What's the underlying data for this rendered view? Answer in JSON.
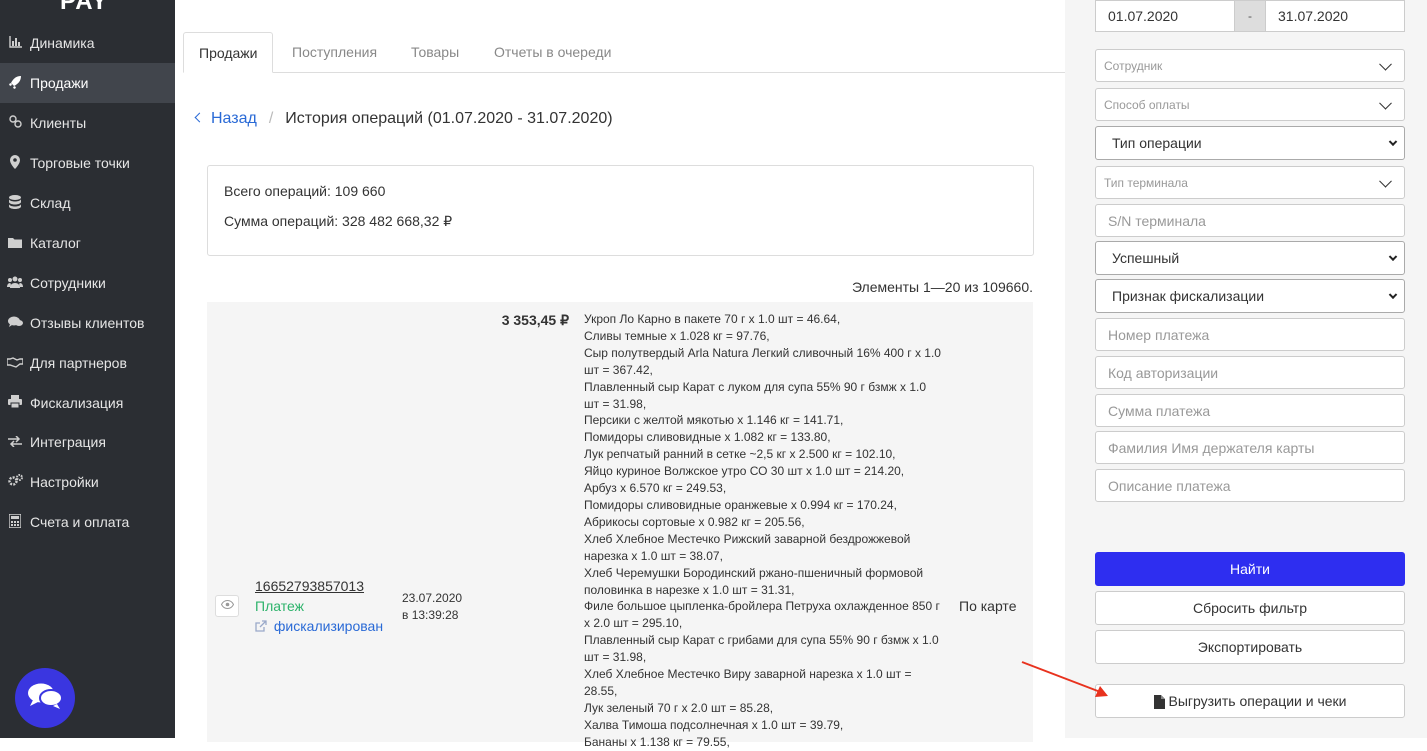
{
  "app": {
    "logo": "PAY"
  },
  "sidebar": {
    "items": [
      {
        "label": "Динамика",
        "icon": "bar-chart-icon"
      },
      {
        "label": "Продажи",
        "icon": "rocket-icon"
      },
      {
        "label": "Клиенты",
        "icon": "link-icon"
      },
      {
        "label": "Торговые точки",
        "icon": "map-pin-icon"
      },
      {
        "label": "Склад",
        "icon": "database-icon"
      },
      {
        "label": "Каталог",
        "icon": "folder-icon"
      },
      {
        "label": "Сотрудники",
        "icon": "users-icon"
      },
      {
        "label": "Отзывы клиентов",
        "icon": "comments-icon"
      },
      {
        "label": "Для партнеров",
        "icon": "handshake-icon"
      },
      {
        "label": "Фискализация",
        "icon": "printer-icon"
      },
      {
        "label": "Интеграция",
        "icon": "exchange-icon"
      },
      {
        "label": "Настройки",
        "icon": "gears-icon"
      },
      {
        "label": "Счета и оплата",
        "icon": "calculator-icon"
      }
    ],
    "active_index": 1
  },
  "tabs": [
    "Продажи",
    "Поступления",
    "Товары",
    "Отчеты в очереди"
  ],
  "breadcrumb": {
    "back": "Назад",
    "separator": "/",
    "current": "История операций (01.07.2020 - 31.07.2020)"
  },
  "summary": {
    "total_ops": "Всего операций: 109 660",
    "total_sum": "Сумма операций: 328 482 668,32 ₽"
  },
  "counter": "Элементы 1—20 из 109660.",
  "operation": {
    "id": "16652793857013",
    "type": "Платеж",
    "fiscal": "фискализирован",
    "date": "23.07.2020",
    "time": "в 13:39:28",
    "amount": "3 353,45 ₽",
    "method": "По карте",
    "items": [
      "Укроп Ло Карно в пакете 70 г x 1.0 шт = 46.64,",
      "Сливы темные x 1.028 кг = 97.76,",
      "Сыр полутвердый Arla Natura Легкий сливочный 16% 400 г x 1.0 шт = 367.42,",
      "Плавленный сыр Карат с луком для супа 55% 90 г бзмж x 1.0 шт = 31.98,",
      "Персики с желтой мякотью x 1.146 кг = 141.71,",
      "Помидоры сливовидные x 1.082 кг = 133.80,",
      "Лук репчатый ранний в сетке ~2,5 кг x 2.500 кг = 102.10,",
      "Яйцо куриное Волжское утро СО 30 шт x 1.0 шт = 214.20,",
      "Арбуз x 6.570 кг = 249.53,",
      "Помидоры сливовидные оранжевые x 0.994 кг = 170.24,",
      "Абрикосы сортовые x 0.982 кг = 205.56,",
      "Хлеб Хлебное Местечко Рижский заварной бездрожжевой нарезка x 1.0 шт = 38.07,",
      "Хлеб Черемушки Бородинский ржано-пшеничный формовой половинка в нарезке x 1.0 шт = 31.31,",
      "Филе большое цыпленка-бройлера Петруха охлажденное 850 г x 2.0 шт = 295.10,",
      "Плавленный сыр Карат с грибами для супа 55% 90 г бзмж x 1.0 шт = 31.98,",
      "Хлеб Хлебное Местечко Виру заварной нарезка x 1.0 шт = 28.55,",
      "Лук зеленый 70 г x 2.0 шт = 85.28,",
      "Халва Тимоша подсолнечная x 1.0 шт = 39.79,",
      "Бананы x 1.138 кг = 79.55,"
    ]
  },
  "filters": {
    "date_from": "01.07.2020",
    "date_sep": "-",
    "date_to": "31.07.2020",
    "employee": "Сотрудник",
    "payment_method": "Способ оплаты",
    "op_type": "Тип операции",
    "terminal_type": "Тип терминала",
    "terminal_sn": "S/N терминала",
    "status": "Успешный",
    "fiscal_sign": "Признак фискализации",
    "payment_number": "Номер платежа",
    "auth_code": "Код авторизации",
    "payment_sum": "Сумма платежа",
    "cardholder": "Фамилия Имя держателя карты",
    "payment_desc": "Описание платежа"
  },
  "buttons": {
    "find": "Найти",
    "reset": "Сбросить фильтр",
    "export": "Экспортировать",
    "download": "Выгрузить операции и чеки"
  },
  "colors": {
    "primary": "#2e2ef0",
    "sidebar": "#2b2e33",
    "link": "#2a6ad6",
    "success": "#2db36b",
    "annotation_arrow": "#e8321e"
  }
}
